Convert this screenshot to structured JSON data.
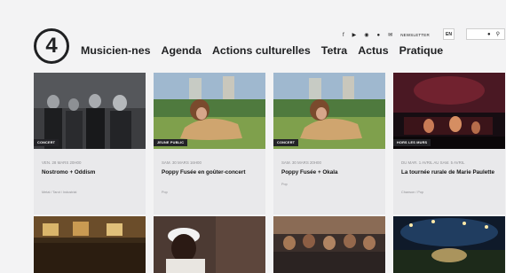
{
  "logo": {
    "glyph": "4"
  },
  "nav": [
    "Musicien-nes",
    "Agenda",
    "Actions culturelles",
    "Tetra",
    "Actus",
    "Pratique"
  ],
  "social": {
    "newsletter": "NEWSLETTER",
    "icons": [
      "facebook-icon",
      "youtube-icon",
      "instagram-icon",
      "spotify-icon",
      "mail-icon"
    ]
  },
  "lang": "EN",
  "cards": [
    {
      "badge": "CONCERT",
      "date": "VEN. 28 MARS 20H00",
      "title": "Nostromo + Oddism",
      "tags": "Metal / Tarot / Industrial"
    },
    {
      "badge": "JEUNE PUBLIC",
      "date": "SAM. 30 MARS 16H00",
      "title": "Poppy Fusée en goûter-concert",
      "tags": "Pop"
    },
    {
      "badge": "CONCERT",
      "date": "SAM. 30 MARS 20H00",
      "title": "Poppy Fusée + Okala",
      "tags": "Pop"
    },
    {
      "badge": "HORS LES MURS",
      "date": "DU MAR. 1 AVRIL AU SAM. 5 AVRIL",
      "title": "La tournée rurale de Marie Paulette",
      "tags": "Chanson / Pop"
    }
  ],
  "colors": {
    "bg": "#f3f3f4",
    "card": "#e9e9eb",
    "badge": "#232327",
    "text": "#1f2022"
  }
}
